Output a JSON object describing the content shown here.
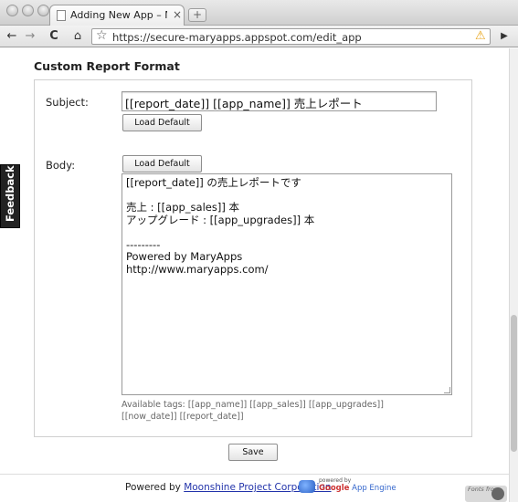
{
  "browser": {
    "tab_title": "Adding New App – Mary App",
    "tab_close": "×",
    "new_tab": "+",
    "url": "https://secure-maryapps.appspot.com/edit_app",
    "back": "←",
    "forward": "→",
    "reload": "C",
    "home": "⌂",
    "star": "☆",
    "warning": "⚠",
    "page_menu": "▶"
  },
  "page": {
    "section_title": "Custom Report Format",
    "subject_label": "Subject:",
    "subject_value": "[[report_date]] [[app_name]] 売上レポート",
    "load_default_label": "Load Default",
    "body_label": "Body:",
    "body_value": "[[report_date]] の売上レポートです\n\n売上 : [[app_sales]] 本\nアップグレード : [[app_upgrades]] 本\n\n---------\nPowered by MaryApps\nhttp://www.maryapps.com/",
    "available_tags": "Available tags: [[app_name]] [[app_sales]] [[app_upgrades]] [[now_date]] [[report_date]]",
    "save_label": "Save"
  },
  "footer": {
    "powered_by": "Powered by",
    "link_text": "Moonshine Project Corporation",
    "gae_small": "powered by",
    "gae_google": "Google",
    "gae_app_engine": "App Engine",
    "fonts_from": "Fonts from"
  },
  "feedback_label": "Feedback",
  "icons": [
    "close-icon",
    "back-icon",
    "forward-icon",
    "reload-icon",
    "home-icon",
    "star-icon",
    "warning-icon",
    "page-menu-icon",
    "app-engine-icon"
  ]
}
